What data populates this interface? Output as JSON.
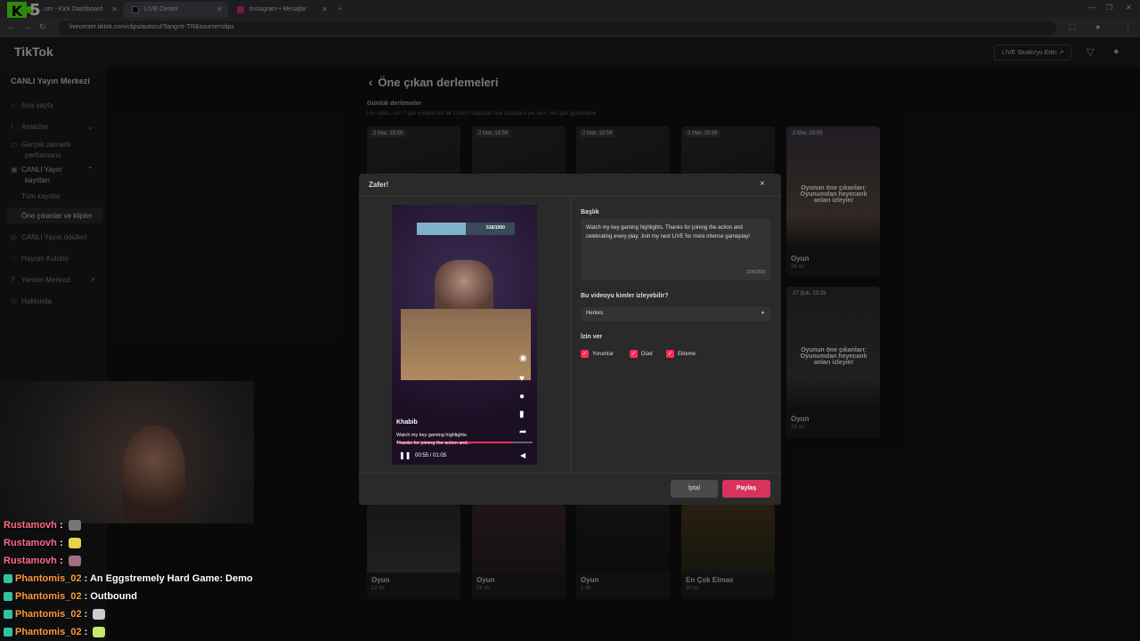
{
  "browser": {
    "tabs": [
      {
        "label": "...om - Kick Dashboard"
      },
      {
        "label": "LIVE Center"
      },
      {
        "label": "Instagram • Mesajlar"
      }
    ],
    "url": "livecenter.tiktok.com/clips/autocut?lang=tr-TR&source=clips",
    "new_tab": "+"
  },
  "overlay": {
    "kick_logo": "K",
    "kick_number": "5"
  },
  "header": {
    "logo": "TikTok",
    "live_studio": "LIVE Studio'yu Edin ↗"
  },
  "sidebar": {
    "title": "CANLI Yayın Merkezi",
    "items": [
      {
        "label": "Ana sayfa"
      },
      {
        "label": "Analizler"
      },
      {
        "label": "Gerçek zamanlı"
      },
      {
        "label": "performans"
      },
      {
        "label": "CANLI Yayın"
      },
      {
        "label": "kayıtları"
      },
      {
        "label": "Tüm kayıtlar"
      },
      {
        "label": "Öne çıkanlar ve klipler"
      },
      {
        "label": "CANLI Yayın ödülleri"
      },
      {
        "label": "Hayran Kulübü"
      },
      {
        "label": "Yardım Merkezi"
      },
      {
        "label": "Hakkında"
      }
    ]
  },
  "main": {
    "back": "‹",
    "title": "Öne çıkan derlemeleri",
    "section_title": "Günlük derlemeler",
    "section_desc": "Her video, son 7 gün içindeki tek bir CANLI Yayından öne çıkanlara yer verir. Her gün güncellenir.",
    "top_dates": [
      "2 Mar, 19:59",
      "2 Mar, 19:59",
      "2 Mar, 19:59",
      "2 Mar, 19:59",
      "2 Mar, 19:59"
    ],
    "card_right1": {
      "overlay": "Oyunun öne çıkanları: Oyunumdan heyecanlı anları izleyin!",
      "title": "Oyun",
      "dur": "36 sn"
    },
    "card_right2": {
      "date": "27 Şub, 23:29",
      "overlay": "Oyunun öne çıkanları: Oyunumdan heyecanlı anları izleyin!",
      "title": "Oyun",
      "dur": "19 sn"
    },
    "bottom_cards": [
      {
        "title": "Oyun",
        "dur": "12 sn"
      },
      {
        "title": "Oyun",
        "dur": "26 sn"
      },
      {
        "title": "Oyun",
        "dur": "1 dk"
      },
      {
        "title": "En Çok Elmas",
        "dur": "30 sn"
      }
    ]
  },
  "modal": {
    "title": "Zafer!",
    "close": "×",
    "video": {
      "banner_count": "518/1000",
      "username": "Khabib",
      "caption1": "Watch my key gaming highlights.",
      "caption2": "Thanks for joining the action and...",
      "time": "00:55 / 01:05",
      "progress": 0.85
    },
    "caption_label": "Başlık",
    "caption_value": "Watch my key gaming highlights. Thanks for joining the action and celebrating every play. Join my next LIVE for more intense gameplay!",
    "char_count": "134/2200",
    "visibility_label": "Bu videoyu kimler izleyebilir?",
    "visibility_value": "Herkes",
    "allow_label": "İzin ver",
    "checks": [
      {
        "label": "Yorumlar"
      },
      {
        "label": "Düet"
      },
      {
        "label": "Ekleme"
      }
    ],
    "cancel": "İptal",
    "share": "Paylaş"
  },
  "chat": [
    {
      "user": "Rustamovh",
      "text": ""
    },
    {
      "user": "Rustamovh",
      "text": ""
    },
    {
      "user": "Rustamovh",
      "text": ""
    },
    {
      "user": "Phantomis_02",
      "text": "An Eggstremely Hard Game: Demo"
    },
    {
      "user": "Phantomis_02",
      "text": "Outbound"
    },
    {
      "user": "Phantomis_02",
      "text": ""
    },
    {
      "user": "Phantomis_02",
      "text": ""
    }
  ],
  "colors": {
    "accent": "#fe2c55",
    "share": "#d8325d"
  }
}
